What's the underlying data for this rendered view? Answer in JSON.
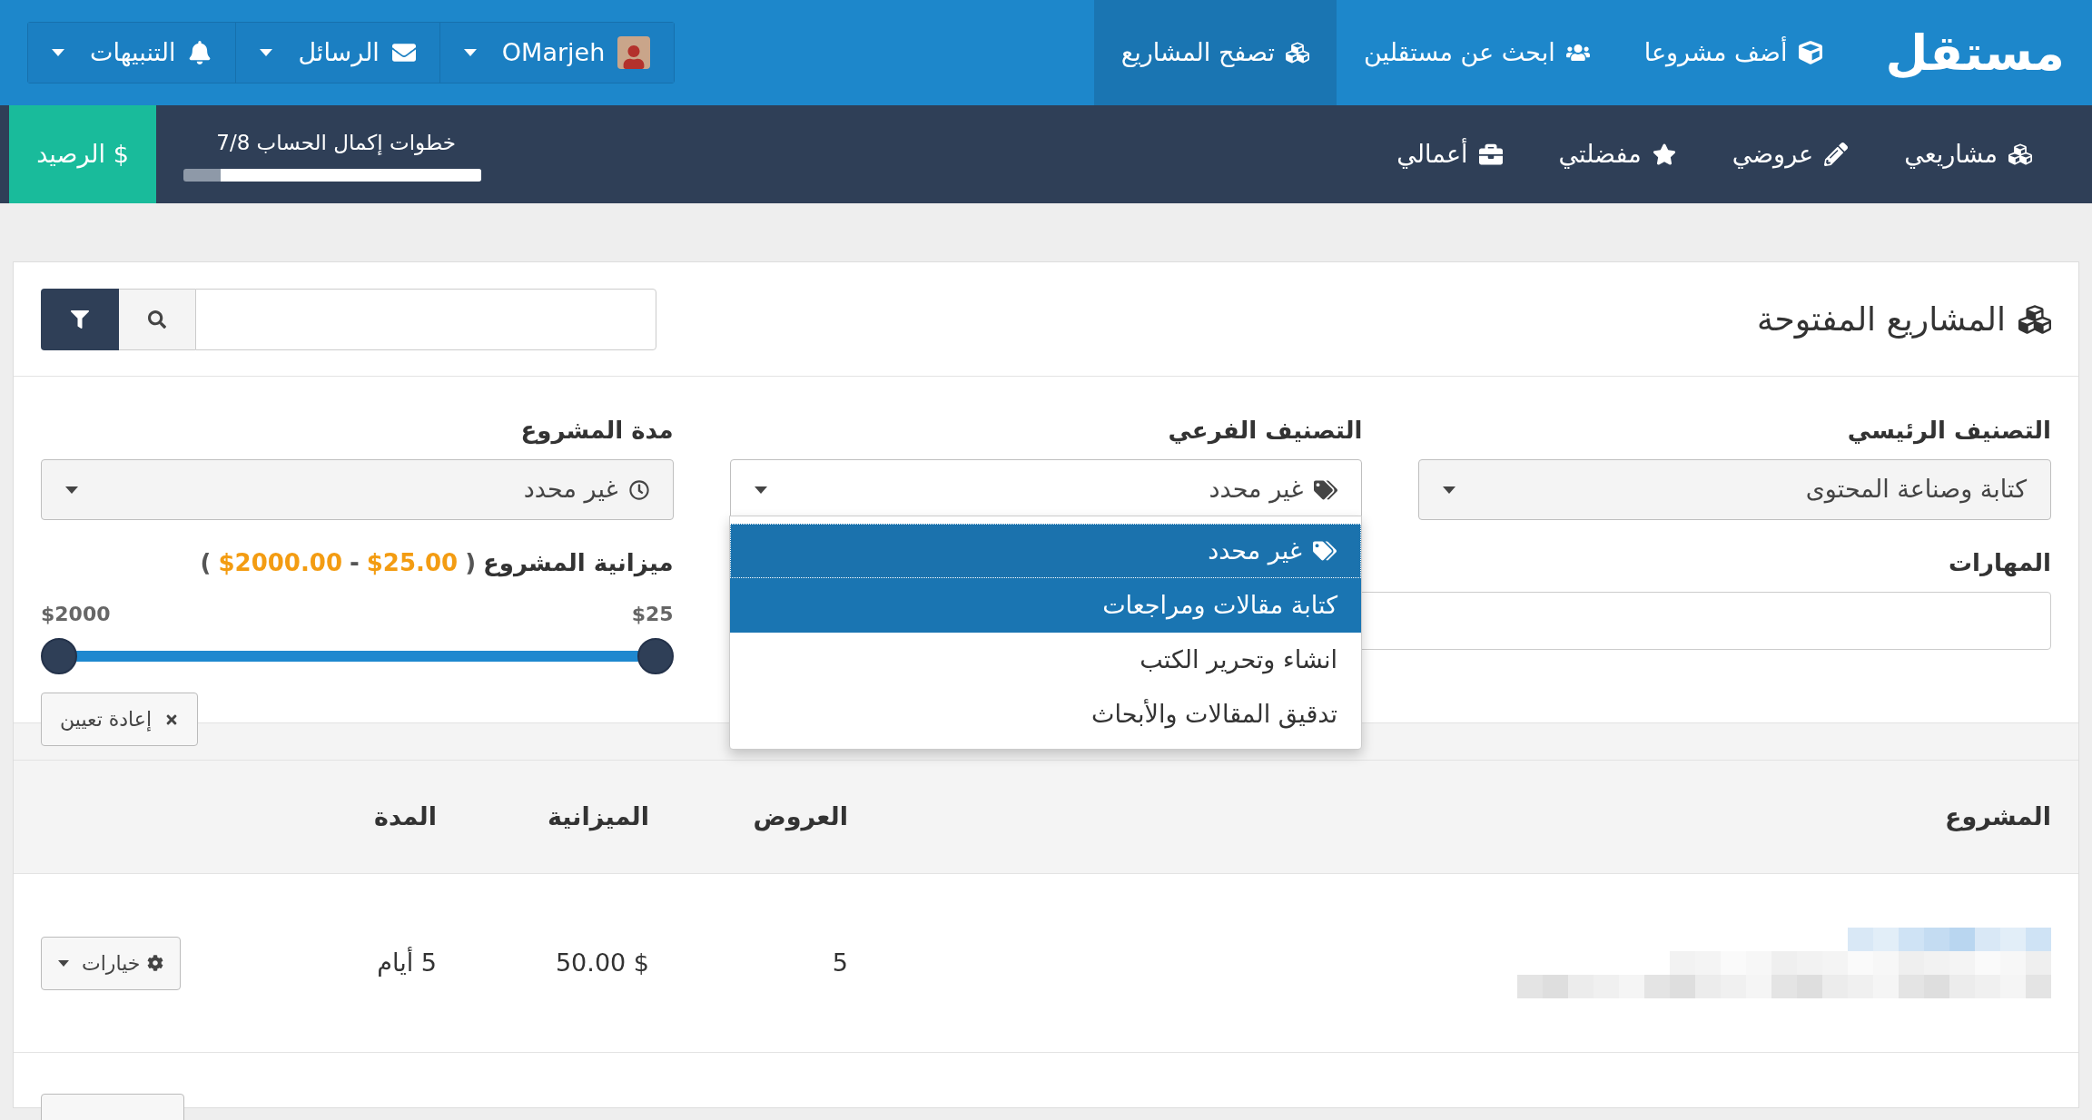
{
  "top_nav": {
    "logo": "مستقل",
    "items": [
      {
        "label": "أضف مشروعا",
        "selected": false
      },
      {
        "label": "ابحث عن مستقلين",
        "selected": false
      },
      {
        "label": "تصفح المشاريع",
        "selected": true
      }
    ],
    "user_menu": [
      {
        "kind": "user",
        "label": "OMarjeh"
      },
      {
        "kind": "messages",
        "label": "الرسائل"
      },
      {
        "kind": "notifications",
        "label": "التنبيهات"
      }
    ]
  },
  "sub_nav": {
    "items": [
      {
        "kind": "projects",
        "label": "مشاريعي"
      },
      {
        "kind": "bids",
        "label": "عروضي"
      },
      {
        "kind": "favorites",
        "label": "مفضلتي"
      },
      {
        "kind": "works",
        "label": "أعمالي"
      }
    ],
    "progress": {
      "label": "خطوات إكمال الحساب 7/8",
      "level": 0.875
    },
    "balance_button": "$ الرصيد"
  },
  "panel": {
    "title": "المشاريع المفتوحة"
  },
  "filters": {
    "main_category": {
      "label": "التصنيف الرئيسي",
      "value": "كتابة وصناعة المحتوى"
    },
    "sub_category": {
      "label": "التصنيف الفرعي",
      "value": "غير محدد",
      "expanded": true,
      "options": [
        {
          "label": "غير محدد",
          "selected": true,
          "hovered": false
        },
        {
          "label": "كتابة مقالات ومراجعات",
          "selected": false,
          "hovered": true
        },
        {
          "label": "انشاء وتحرير الكتب",
          "selected": false,
          "hovered": false
        },
        {
          "label": "تدقيق المقالات والأبحاث",
          "selected": false,
          "hovered": false
        }
      ]
    },
    "duration": {
      "label": "مدة المشروع",
      "value": "غير محدد"
    },
    "skills": {
      "label": "المهارات"
    },
    "budget": {
      "label": "ميزانية المشروع",
      "range_open": "(",
      "range_min": "$25.00",
      "range_separator": "-",
      "range_max": "$2000.00",
      "range_close": ")",
      "slider_min": "$25",
      "slider_max": "$2000",
      "thumbs": [
        {
          "level": 0
        },
        {
          "level": 1
        }
      ]
    },
    "reset_button": "إعادة تعيين"
  },
  "table": {
    "columns": [
      "المشروع",
      "العروض",
      "الميزانية",
      "المدة"
    ],
    "rows": [
      {
        "offers": "5",
        "budget": "$ 50.00",
        "duration": "5 أيام",
        "options_button": "خيارات"
      }
    ]
  }
}
